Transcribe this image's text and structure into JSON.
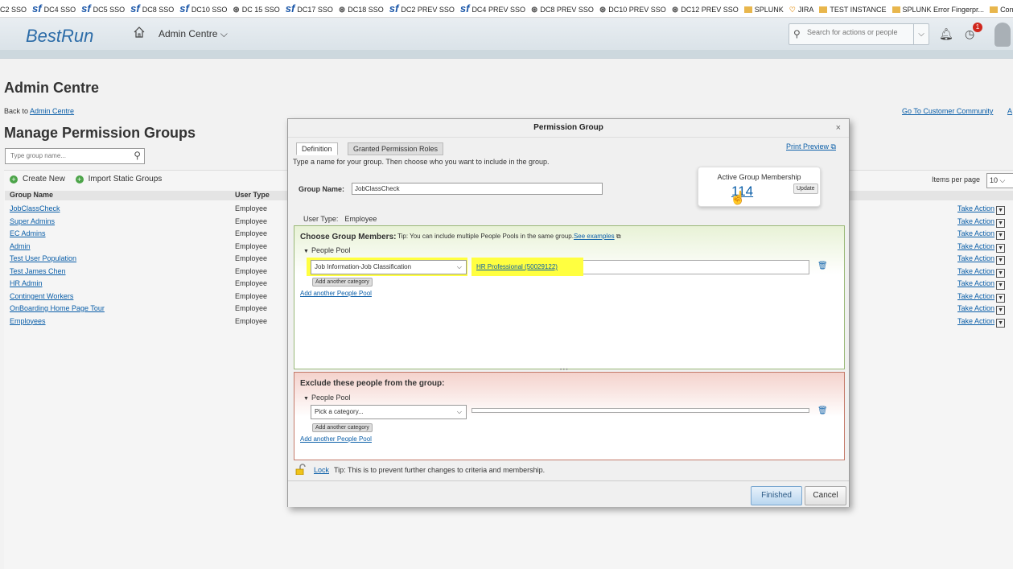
{
  "bookmarks": [
    {
      "icon": "none",
      "label": "C2 SSO"
    },
    {
      "icon": "sf",
      "label": "DC4 SSO"
    },
    {
      "icon": "sf",
      "label": "DC5 SSO"
    },
    {
      "icon": "sf",
      "label": "DC8 SSO"
    },
    {
      "icon": "sf",
      "label": "DC10 SSO"
    },
    {
      "icon": "globe",
      "label": "DC 15 SSO"
    },
    {
      "icon": "sf",
      "label": "DC17 SSO"
    },
    {
      "icon": "globe",
      "label": "DC18 SSO"
    },
    {
      "icon": "sf",
      "label": "DC2 PREV SSO"
    },
    {
      "icon": "sf",
      "label": "DC4 PREV SSO"
    },
    {
      "icon": "globe",
      "label": "DC8 PREV SSO"
    },
    {
      "icon": "globe",
      "label": "DC10 PREV SSO"
    },
    {
      "icon": "globe",
      "label": "DC12 PREV SSO"
    },
    {
      "icon": "folder",
      "label": "SPLUNK"
    },
    {
      "icon": "heart",
      "label": "JIRA"
    },
    {
      "icon": "folder",
      "label": "TEST INSTANCE"
    },
    {
      "icon": "folder",
      "label": "SPLUNK Error Fingerpr..."
    },
    {
      "icon": "folder",
      "label": "Confluence - P"
    }
  ],
  "header": {
    "logo": "BestRun",
    "module": "Admin Centre",
    "module_chevron": "⌵",
    "search_placeholder": "Search for actions or people",
    "notification_count": "1"
  },
  "page": {
    "title": "Admin Centre",
    "back_prefix": "Back to ",
    "back_link": "Admin Centre",
    "customer_community": "Go To Customer Community",
    "customer_community_tail": "A",
    "section_title": "Manage Permission Groups",
    "group_search_placeholder": "Type group name...",
    "create_new": "Create New",
    "import_static": "Import Static Groups",
    "items_per_page_label": "Items per page",
    "items_per_page_value": "10",
    "col_group_name": "Group Name",
    "col_user_type": "User Type"
  },
  "groups": [
    {
      "name": "JobClassCheck",
      "type": "Employee",
      "action": "Take Action"
    },
    {
      "name": "Super Admins",
      "type": "Employee",
      "action": "Take Action"
    },
    {
      "name": "EC Admins",
      "type": "Employee",
      "action": "Take Action"
    },
    {
      "name": "Admin",
      "type": "Employee",
      "action": "Take Action"
    },
    {
      "name": "Test User Population",
      "type": "Employee",
      "action": "Take Action"
    },
    {
      "name": "Test James Chen",
      "type": "Employee",
      "action": "Take Action"
    },
    {
      "name": "HR Admin",
      "type": "Employee",
      "action": "Take Action"
    },
    {
      "name": "Contingent Workers",
      "type": "Employee",
      "action": "Take Action"
    },
    {
      "name": "OnBoarding Home Page Tour",
      "type": "Employee",
      "action": "Take Action"
    },
    {
      "name": "Employees",
      "type": "Employee",
      "action": "Take Action"
    }
  ],
  "dialog": {
    "title": "Permission Group",
    "close": "×",
    "tab_definition": "Definition",
    "tab_roles": "Granted Permission Roles",
    "print_preview": "Print Preview",
    "intro": "Type a name for your group. Then choose who you want to include in the group.",
    "group_name_label": "Group Name:",
    "group_name_value": "JobClassCheck",
    "active_membership_label": "Active Group Membership",
    "active_membership_count": "114",
    "update_button": "Update",
    "user_type_label": "User Type:",
    "user_type_value": "Employee",
    "choose_title": "Choose Group Members:",
    "choose_tip": "Tip: You can include multiple People Pools in the same group.",
    "see_examples": "See examples",
    "people_pool": "People Pool",
    "category_value": "Job Information-Job Classification",
    "category_selection": "HR Professional (50029122)",
    "add_category": "Add another category",
    "add_pool": "Add another People Pool",
    "exclude_title": "Exclude these people from the group:",
    "exclude_pool": "People Pool",
    "exclude_category_placeholder": "Pick a category...",
    "exclude_add_category": "Add another category",
    "exclude_add_pool": "Add another People Pool",
    "lock_link": "Lock",
    "lock_tip": "Tip: This is to prevent further changes to criteria and membership.",
    "finished": "Finished",
    "cancel": "Cancel"
  }
}
